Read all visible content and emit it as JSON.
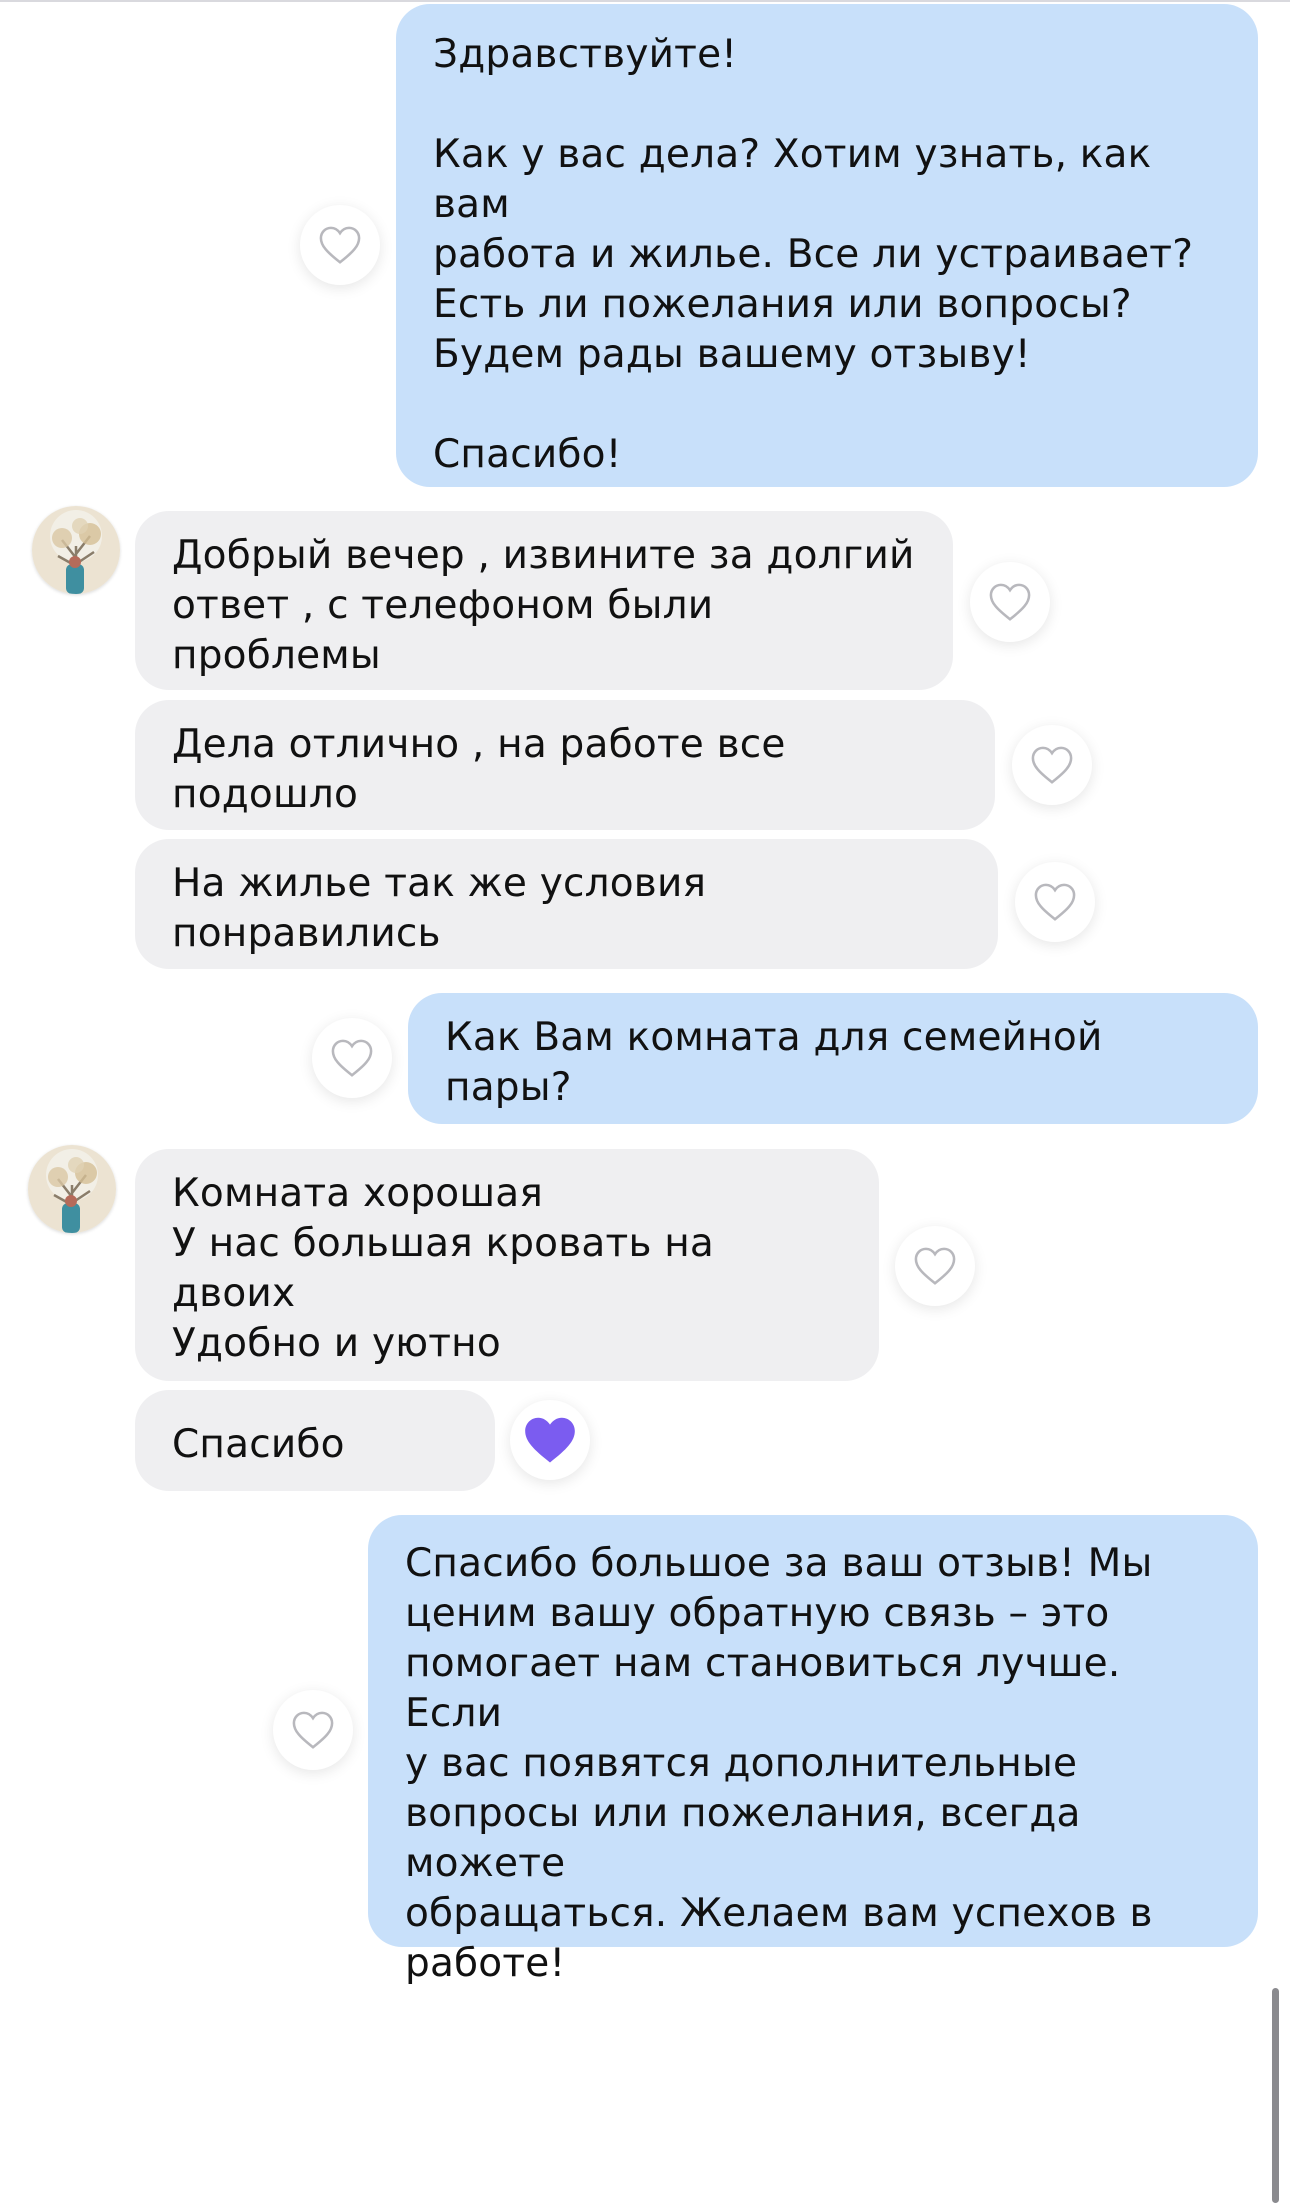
{
  "messages": [
    {
      "side": "out",
      "text": "Здравствуйте!\n\nКак у вас дела? Хотим узнать, как вам\nработа и жилье. Все ли устраивает?\nЕсть ли пожелания или вопросы?\nБудем рады вашему отзыву!\n\nСпасибо!",
      "liked": false
    },
    {
      "side": "in",
      "text": "Добрый вечер , извините за долгий\nответ , с телефоном были проблемы",
      "liked": false
    },
    {
      "side": "in",
      "text": "Дела отлично , на работе все подошло",
      "liked": false
    },
    {
      "side": "in",
      "text": "На жилье так же условия понравились",
      "liked": false
    },
    {
      "side": "out",
      "text": "Как Вам комната для семейной пары?",
      "liked": false
    },
    {
      "side": "in",
      "text": "Комната хорошая\nУ нас большая кровать на двоих\nУдобно и уютно",
      "liked": false
    },
    {
      "side": "in",
      "text": "Спасибо",
      "liked": true
    },
    {
      "side": "out",
      "text": "Спасибо большое за ваш отзыв! Мы\nценим вашу обратную связь – это\nпомогает нам становиться лучше. Если\nу вас появятся дополнительные\nвопросы или пожелания, всегда можете\nобращаться. Желаем вам успехов в\nработе!",
      "liked": false
    }
  ],
  "icons": {
    "like": "heart-outline-icon",
    "liked": "heart-filled-icon",
    "avatar": "contact-avatar"
  },
  "colors": {
    "outgoing_bubble": "#c8e0fa",
    "incoming_bubble": "#efeff1",
    "liked_heart": "#7b5cf0",
    "heart_outline": "#b8b8bd"
  }
}
